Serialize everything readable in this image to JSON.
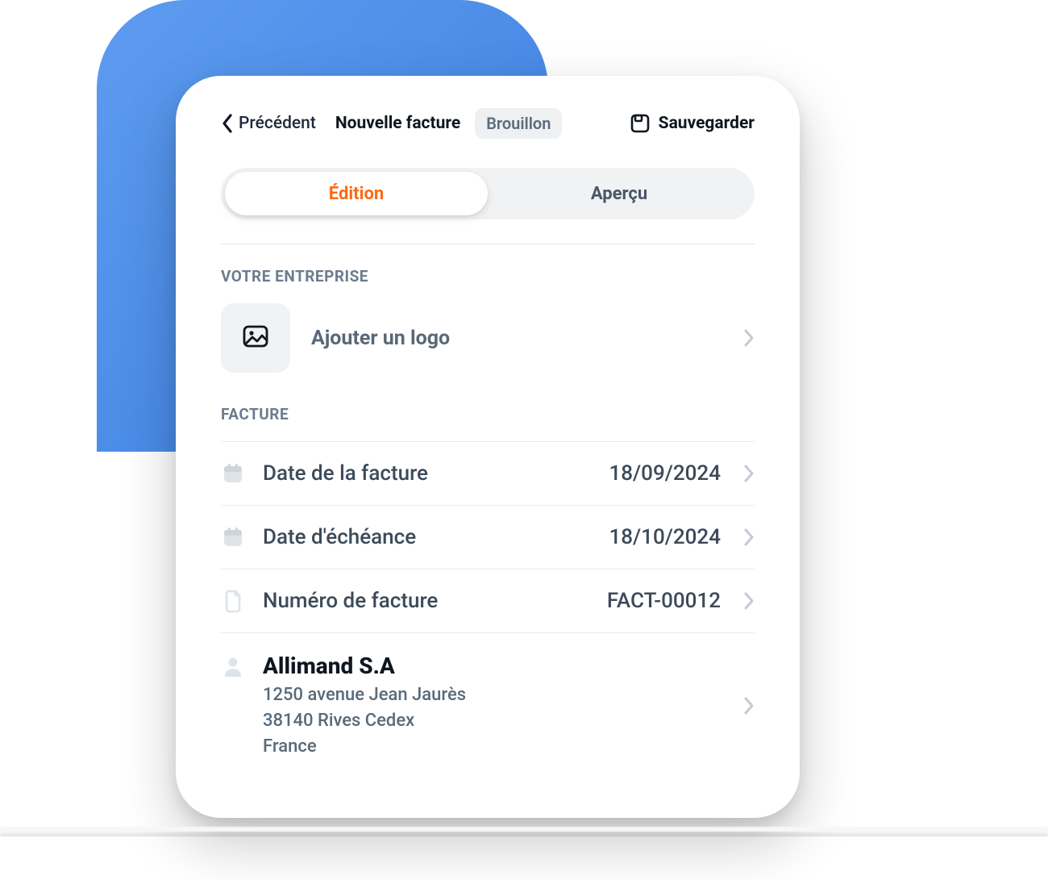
{
  "header": {
    "back_label": "Précédent",
    "title": "Nouvelle facture",
    "status_badge": "Brouillon",
    "save_label": "Sauvegarder"
  },
  "tabs": {
    "edit": "Édition",
    "preview": "Aperçu"
  },
  "sections": {
    "company_label": "VOTRE ENTREPRISE",
    "invoice_label": "FACTURE"
  },
  "company": {
    "add_logo_label": "Ajouter un logo"
  },
  "invoice": {
    "date_label": "Date de la facture",
    "date_value": "18/09/2024",
    "due_label": "Date d'échéance",
    "due_value": "18/10/2024",
    "number_label": "Numéro de facture",
    "number_value": "FACT-00012"
  },
  "client": {
    "name": "Allimand S.A",
    "address_line1": "1250 avenue Jean Jaurès",
    "address_line2": "38140 Rives Cedex",
    "country": "France"
  },
  "colors": {
    "accent": "#ff6a13",
    "blob_start": "#5e9cf0",
    "blob_end": "#3b7ee0"
  }
}
